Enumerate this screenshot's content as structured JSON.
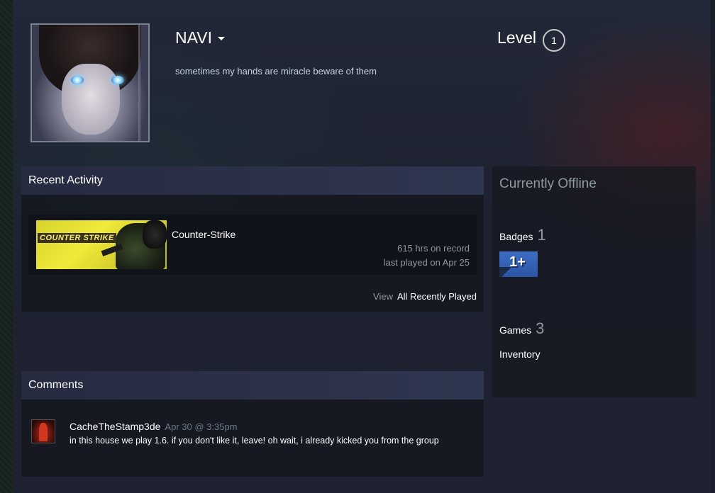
{
  "profile": {
    "persona_name": "NAVI",
    "summary": "sometimes my hands are miracle beware of them",
    "level_label": "Level",
    "level_value": "1"
  },
  "recent_activity": {
    "header": "Recent Activity",
    "game": {
      "name": "Counter-Strike",
      "capsule_logo": "COUNTER STRIKE",
      "hours": "615 hrs on record",
      "last_played": "last played on Apr 25"
    },
    "view_label": "View",
    "view_link": "All Recently Played"
  },
  "comments": {
    "header": "Comments",
    "items": [
      {
        "author": "CacheTheStamp3de",
        "time": "Apr 30 @ 3:35pm",
        "text": "in this house we play 1.6. if you don't like it, leave! oh wait, i already kicked you from the group"
      }
    ]
  },
  "sidebar": {
    "status": "Currently Offline",
    "badges_label": "Badges",
    "badges_count": "1",
    "badge_icon_text": "1+",
    "games_label": "Games",
    "games_count": "3",
    "inventory_label": "Inventory"
  },
  "colors": {
    "page_bg": "#1b1f2a",
    "header_bg": "#2f3852",
    "muted_text": "#8f98a0",
    "badge_blue": "#3d6ec5"
  },
  "icons": [
    "caret-down-icon",
    "level-circle-icon",
    "badge-1plus-icon"
  ]
}
